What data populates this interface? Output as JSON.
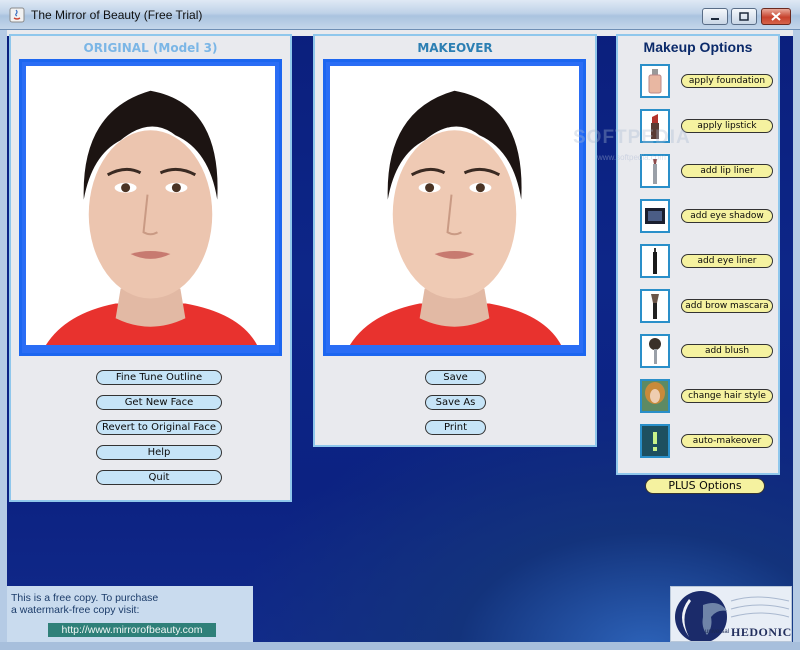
{
  "window": {
    "title": "The Mirror of Beauty (Free Trial)"
  },
  "original_panel": {
    "title": "ORIGINAL (Model 3)",
    "buttons": {
      "fine_tune": "Fine Tune Outline",
      "get_new_face": "Get New Face",
      "revert": "Revert to Original Face",
      "help": "Help",
      "quit": "Quit"
    }
  },
  "makeover_panel": {
    "title": "MAKEOVER",
    "buttons": {
      "save": "Save",
      "save_as": "Save As",
      "print": "Print"
    }
  },
  "makeup_options": {
    "title": "Makeup Options",
    "items": [
      {
        "label": "apply foundation",
        "icon": "foundation-bottle-icon"
      },
      {
        "label": "apply lipstick",
        "icon": "lipstick-icon"
      },
      {
        "label": "add lip liner",
        "icon": "lip-liner-icon"
      },
      {
        "label": "add eye shadow",
        "icon": "eye-shadow-compact-icon"
      },
      {
        "label": "add eye liner",
        "icon": "eye-liner-pencil-icon"
      },
      {
        "label": "add brow mascara",
        "icon": "brow-brush-icon"
      },
      {
        "label": "add blush",
        "icon": "blush-brush-icon"
      },
      {
        "label": "change hair style",
        "icon": "hair-style-icon"
      },
      {
        "label": "auto-makeover",
        "icon": "exclamation-icon"
      }
    ],
    "plus_label": "PLUS Options"
  },
  "footer": {
    "trial_text": "This is a free copy.  To purchase\na watermark-free copy visit:",
    "url": "http://www.mirrorofbeauty.com"
  },
  "watermark": {
    "text": "SOFTPEDIA",
    "url": "www.softpedia.com"
  },
  "logo": {
    "name": "HEDONICS",
    "prefix": "universal"
  },
  "colors": {
    "background": "#0d2688",
    "panel": "#e9eaee",
    "photo_frame": "#1c66f0",
    "button_blue": "#c6e4f7",
    "button_yellow": "#f5f2a0"
  }
}
